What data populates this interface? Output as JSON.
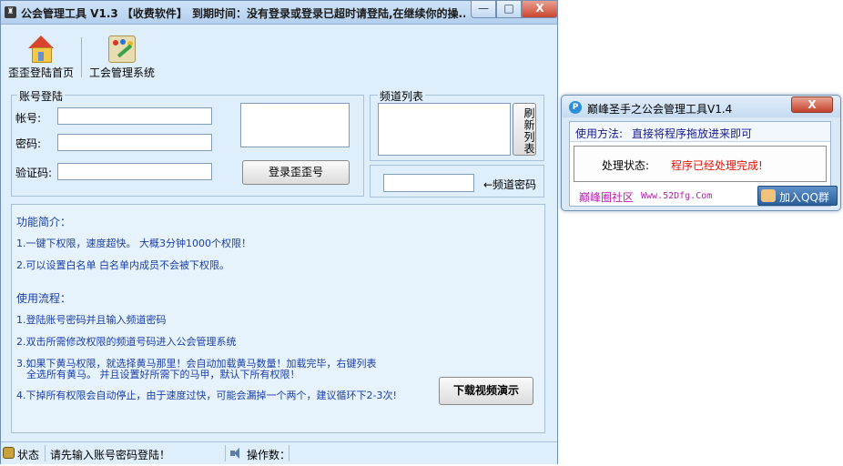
{
  "main_window": {
    "title": "公会管理工具 V1.3 【收费软件】",
    "expire_text": "到期时间：没有登录或登录已超时请登陆,在继续你的操...",
    "controls": {
      "minimize": "—",
      "maximize": "□",
      "close": "X"
    },
    "icon_glyph": "♜"
  },
  "toolbar": {
    "home_label": "歪歪登陆首页",
    "guild_label": "工会管理系统"
  },
  "account": {
    "group_title": "账号登陆",
    "account_label": "帐号:",
    "password_label": "密码:",
    "captcha_label": "验证码:",
    "login_button": "登录歪歪号"
  },
  "channel": {
    "group_title": "频道列表",
    "refresh_button": "刷新列表",
    "password_label": "←频道密码"
  },
  "intro": {
    "feature_title": "功能简介：",
    "features": [
      "1.一键下权限，速度超快。 大概3分钟1000个权限！",
      "2.可以设置白名单  白名单内成员不会被下权限。"
    ],
    "process_title": "使用流程：",
    "steps": [
      "1.登陆账号密码并且输入频道密码",
      "2.双击所需修改权限的频道号码进入公会管理系统",
      "3.如果下黄马权限，就选择黄马那里！会自动加载黄马数量！加载完毕，右键列表",
      "全选所有黄马。 并且设置好所需下的马甲，默认下所有权限！",
      "4.下掉所有权限会自动停止，由于速度过快，可能会漏掉一个两个，建议循环下2-3次!"
    ],
    "download_button": "下载视频演示"
  },
  "statusbar": {
    "status_label": "状态",
    "status_text": "请先输入账号密码登陆！",
    "ops_label": "操作数："
  },
  "popup": {
    "title": "巅峰圣手之公会管理工具V1.4",
    "icon_glyph": "P",
    "close": "X",
    "usage_label": "使用方法:",
    "usage_text": "直接将程序拖放进来即可",
    "proc_label": "处理状态:",
    "proc_text": "程序已经处理完成!",
    "community": "巅峰圈社区",
    "community_url": "Www.52Dfg.Com",
    "qq_button": "加入QQ群"
  },
  "colors": {
    "window_bg": "#dfeefb",
    "intro_text": "#1a3ea8",
    "status_red": "#e3160c",
    "community_purple": "#b61cb0"
  },
  "icons": [
    "house-icon",
    "palette-icon",
    "ruby-icon",
    "speaker-icon",
    "qq-icon"
  ]
}
